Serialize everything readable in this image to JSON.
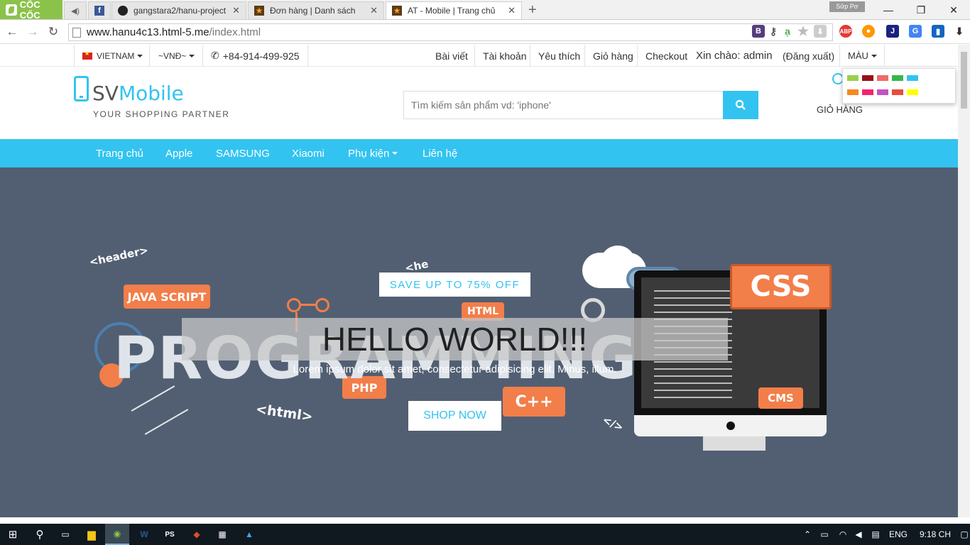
{
  "browser": {
    "brand": "CỐC CỐC",
    "user_chip": "Sửp Pơ",
    "tabs": [
      {
        "label": "",
        "icon": "speaker-icon"
      },
      {
        "label": "",
        "icon": "facebook-icon"
      },
      {
        "label": "gangstara2/hanu-project",
        "icon": "github-icon"
      },
      {
        "label": "Đơn hàng | Danh sách",
        "icon": "star-favicon-icon"
      },
      {
        "label": "AT - Mobile | Trang chủ",
        "icon": "star-favicon-icon"
      }
    ],
    "url_domain": "www.hanu4c13.html-5.me",
    "url_path": "/index.html"
  },
  "topbar": {
    "country": "VIETNAM",
    "currency": "~VNĐ~",
    "phone": "+84-914-499-925",
    "links": [
      "Bài viết",
      "Tài khoản",
      "Yêu thích",
      "Giỏ hàng",
      "Checkout"
    ],
    "greeting": "Xin chào: admin",
    "logout": "(Đăng xuất)",
    "color_menu": "MÀU",
    "swatches": [
      "#9ad04a",
      "#9b0d15",
      "#f06a6a",
      "#39b54a",
      "#33c3f0",
      "#f7891f",
      "#f5246a",
      "#c154c1",
      "#e74c3c",
      "#ffff00"
    ]
  },
  "header": {
    "logo_sv": "SV",
    "logo_mobile": "Mobile",
    "tagline": "YOUR SHOPPING PARTNER",
    "search_placeholder": "Tìm kiếm sản phẩm vd: 'iphone'",
    "cart_label": "GIỎ HÀNG"
  },
  "nav": {
    "items": [
      "Trang chủ",
      "Apple",
      "SAMSUNG",
      "Xiaomi",
      "Phụ kiện",
      "Liên hệ"
    ]
  },
  "hero": {
    "sale": "SAVE UP TO 75% OFF",
    "title": "HELLO WORLD!!!",
    "subtitle": "Lorem ipsum dolor sit amet, consectetur adipisicing elit. Minus, illum.",
    "button": "SHOP NOW",
    "art": {
      "big_word": "PROGRAMMING",
      "tags": [
        "JAVA SCRIPT",
        "HTML",
        "PHP",
        "C++",
        "CSS",
        "CMS"
      ],
      "code_words": [
        "<header>",
        "<html>",
        "</>",
        "<he"
      ]
    }
  },
  "taskbar": {
    "lang": "ENG",
    "time": "9:18 CH"
  }
}
